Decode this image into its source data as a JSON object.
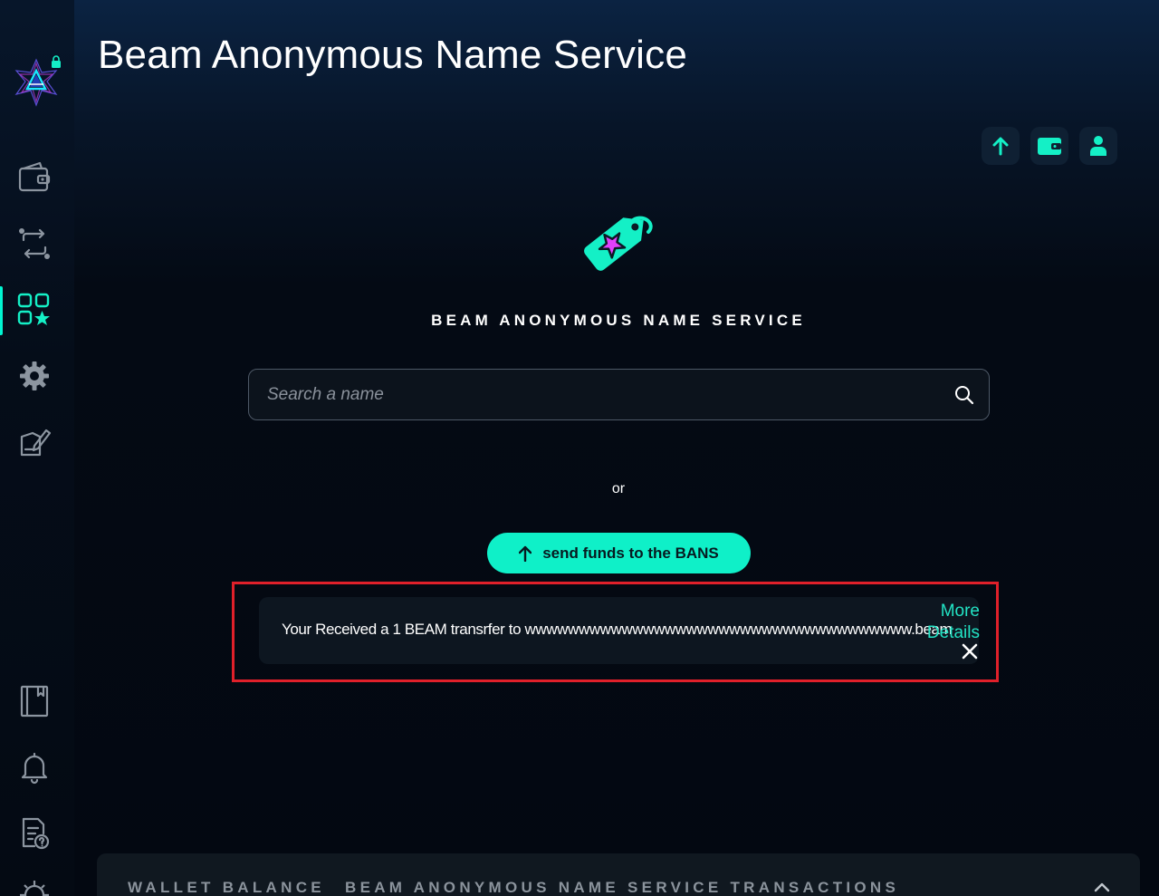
{
  "app": {
    "title": "Beam Anonymous Name Service"
  },
  "sidebar": {
    "items": [
      {
        "name": "wallet"
      },
      {
        "name": "transactions"
      },
      {
        "name": "dapps",
        "active": true
      },
      {
        "name": "settings"
      },
      {
        "name": "edit"
      },
      {
        "name": "notebook"
      },
      {
        "name": "notifications"
      },
      {
        "name": "help-document"
      },
      {
        "name": "settings-bottom"
      }
    ]
  },
  "main": {
    "heading": "BEAM ANONYMOUS NAME SERVICE",
    "search": {
      "placeholder": "Search a name",
      "value": ""
    },
    "or_label": "or",
    "send_button_label": "send funds to the BANS"
  },
  "notification": {
    "message": "Your Received a 1 BEAM transrfer to wwwwwwwwwwwwwwwwwwwwwwwwwwwwwwwwwwww.beam",
    "more_label": "More",
    "details_label": "Details"
  },
  "bottom_panel": {
    "tabs": [
      {
        "label": "WALLET BALANCE"
      },
      {
        "label": "BEAM ANONYMOUS NAME SERVICE TRANSACTIONS"
      }
    ]
  },
  "colors": {
    "accent": "#0ff0c8",
    "highlight": "#e0202a",
    "tag_star": "#e040fb"
  }
}
